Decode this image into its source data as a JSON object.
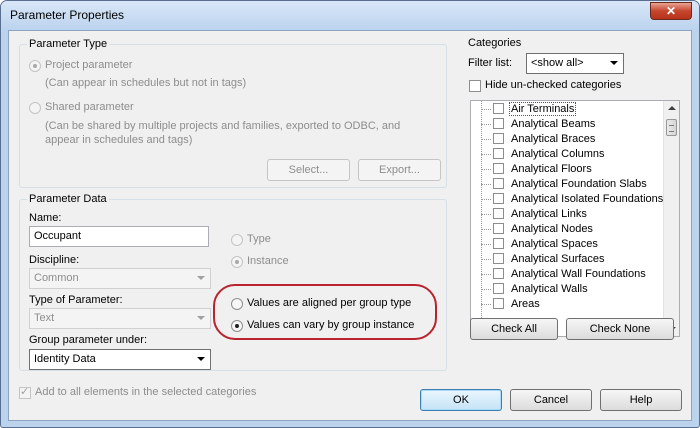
{
  "window": {
    "title": "Parameter Properties",
    "close_glyph": "✕"
  },
  "parameter_type": {
    "legend": "Parameter Type",
    "project_label": "Project parameter",
    "project_hint": "(Can appear in schedules but not in tags)",
    "shared_label": "Shared parameter",
    "shared_hint_1": "(Can be shared by multiple projects and families, exported to ODBC, and",
    "shared_hint_2": "appear in schedules and tags)",
    "select_button": "Select...",
    "export_button": "Export..."
  },
  "parameter_data": {
    "legend": "Parameter Data",
    "name_label": "Name:",
    "name_value": "Occupant",
    "discipline_label": "Discipline:",
    "discipline_value": "Common",
    "type_label": "Type of Parameter:",
    "type_value": "Text",
    "group_label": "Group parameter under:",
    "group_value": "Identity Data",
    "radio_type": "Type",
    "radio_instance": "Instance",
    "radio_aligned": "Values are aligned per group type",
    "radio_vary": "Values can vary by group instance"
  },
  "categories": {
    "legend": "Categories",
    "filter_label": "Filter list:",
    "filter_value": "<show all>",
    "hide_unchecked": "Hide un-checked categories",
    "items": [
      "Air Terminals",
      "Analytical Beams",
      "Analytical Braces",
      "Analytical Columns",
      "Analytical Floors",
      "Analytical Foundation Slabs",
      "Analytical Isolated Foundations",
      "Analytical Links",
      "Analytical Nodes",
      "Analytical Spaces",
      "Analytical Surfaces",
      "Analytical Wall Foundations",
      "Analytical Walls",
      "Areas"
    ],
    "check_all": "Check All",
    "check_none": "Check None"
  },
  "footer": {
    "add_all_label": "Add to all elements in the selected categories",
    "ok": "OK",
    "cancel": "Cancel",
    "help": "Help"
  },
  "colors": {
    "highlight": "#b8232e",
    "titlebar": "#bcd3ee"
  }
}
